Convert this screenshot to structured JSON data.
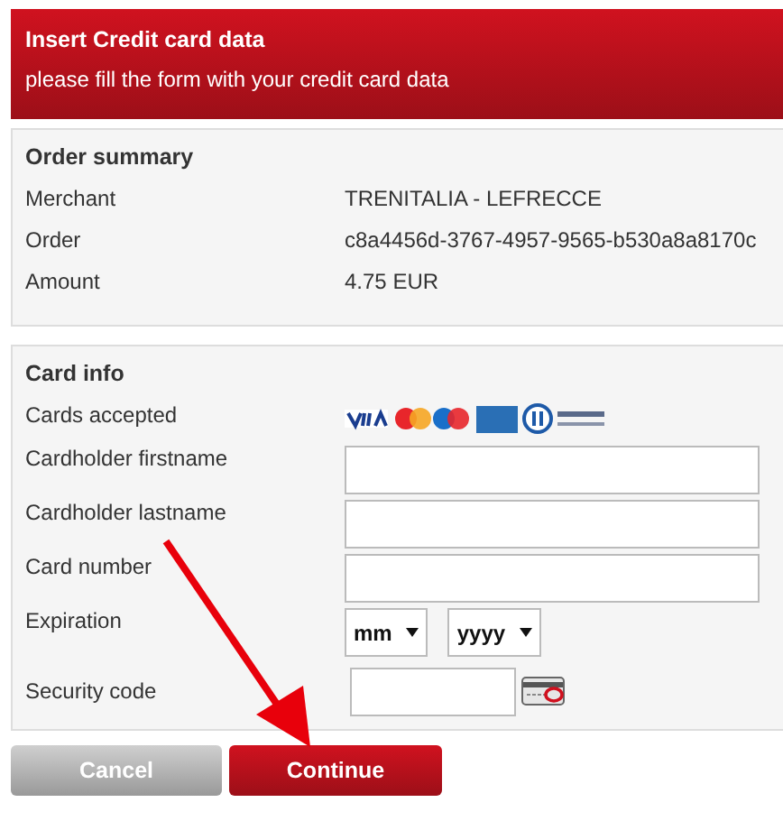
{
  "header": {
    "title": "Insert Credit card data",
    "subtitle": "please fill the form with your credit card data"
  },
  "order_summary": {
    "title": "Order summary",
    "rows": [
      {
        "label": "Merchant",
        "value": "TRENITALIA - LEFRECCE"
      },
      {
        "label": "Order",
        "value": "c8a4456d-3767-4957-9565-b530a8a8170c"
      },
      {
        "label": "Amount",
        "value": "4.75 EUR"
      }
    ]
  },
  "card_info": {
    "title": "Card info",
    "fields": [
      {
        "kind": "cards",
        "label": "Cards accepted"
      },
      {
        "kind": "text",
        "label": "Cardholder firstname"
      },
      {
        "kind": "text",
        "label": "Cardholder lastname"
      },
      {
        "kind": "text",
        "label": "Card number"
      },
      {
        "kind": "expiry",
        "label": "Expiration",
        "month": "mm",
        "year": "yyyy"
      },
      {
        "kind": "cvv",
        "label": "Security code"
      }
    ]
  },
  "buttons": [
    {
      "kind": "cancel",
      "label": "Cancel"
    },
    {
      "kind": "primary",
      "label": "Continue"
    }
  ]
}
